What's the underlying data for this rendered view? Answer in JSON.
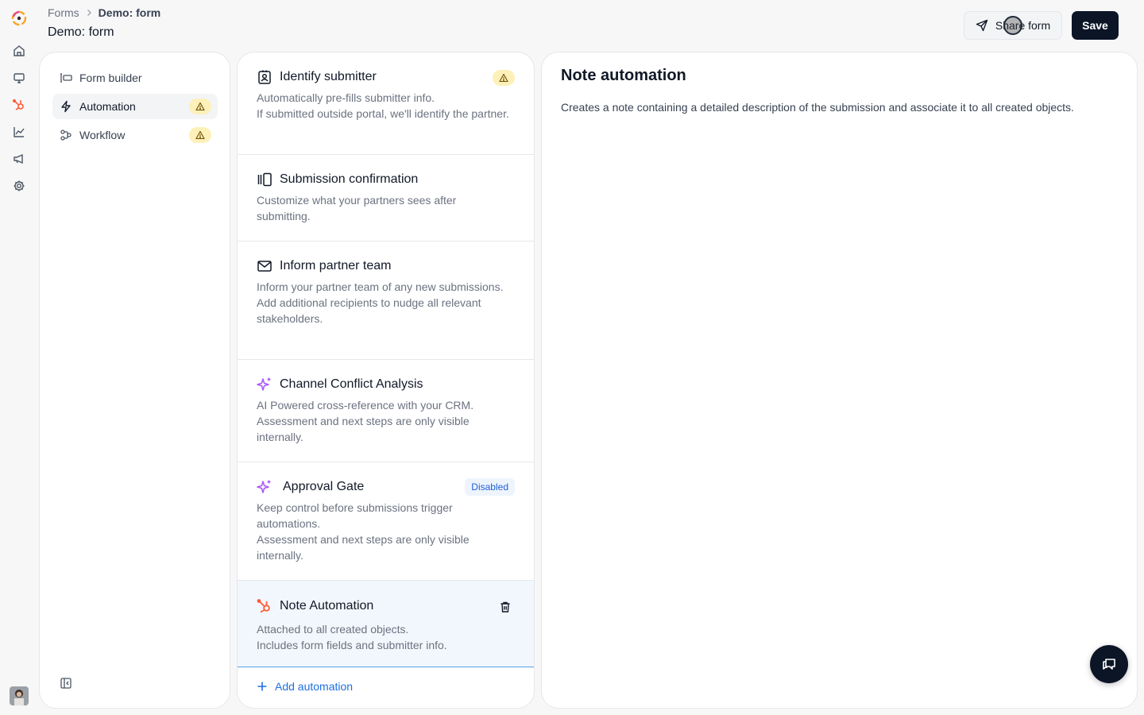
{
  "app": {
    "logo_icon": "brand-logo-icon",
    "rail_icons": [
      "home-icon",
      "monitor-icon",
      "hubspot-icon",
      "chart-icon",
      "megaphone-icon",
      "settings-icon"
    ],
    "hubspot_color": "#ff5c35"
  },
  "header": {
    "breadcrumb_root": "Forms",
    "breadcrumb_current": "Demo: form",
    "title": "Demo: form",
    "share_label": "Share form",
    "save_label": "Save"
  },
  "sidebar": {
    "items": [
      {
        "label": "Form builder",
        "icon": "form-builder-icon",
        "active": false,
        "warning": false
      },
      {
        "label": "Automation",
        "icon": "lightning-icon",
        "active": true,
        "warning": true
      },
      {
        "label": "Workflow",
        "icon": "workflow-icon",
        "active": false,
        "warning": true
      }
    ]
  },
  "automations": {
    "cards": [
      {
        "title": "Identify submitter",
        "icon": "contact-card-icon",
        "desc": [
          "Automatically pre-fills submitter info.",
          "If submitted outside portal, we'll identify the partner."
        ],
        "warning": true
      },
      {
        "title": "Submission confirmation",
        "icon": "gallery-icon",
        "desc": [
          "Customize what your partners sees after submitting."
        ]
      },
      {
        "title": "Inform partner team",
        "icon": "mail-icon",
        "desc": [
          "Inform your partner team of any new submissions.",
          "Add additional recipients to nudge all relevant stakeholders."
        ]
      },
      {
        "title": "Channel Conflict Analysis",
        "icon": "sparkles-icon",
        "desc": [
          "AI Powered cross-reference with your CRM.",
          "Assessment and next steps are only visible internally."
        ]
      },
      {
        "title": "Approval Gate",
        "icon": "sparkles-icon",
        "badge": "Disabled",
        "desc": [
          "Keep control before submissions trigger automations.",
          "Assessment and next steps are only visible internally."
        ]
      },
      {
        "title": "Note Automation",
        "icon": "hubspot-icon",
        "selected": true,
        "desc": [
          "Attached to all created objects.",
          "Includes form fields and submitter info."
        ]
      }
    ],
    "add_label": "Add automation"
  },
  "detail": {
    "title": "Note automation",
    "description": "Creates a note containing a detailed description of the submission and associate it to all created objects."
  }
}
